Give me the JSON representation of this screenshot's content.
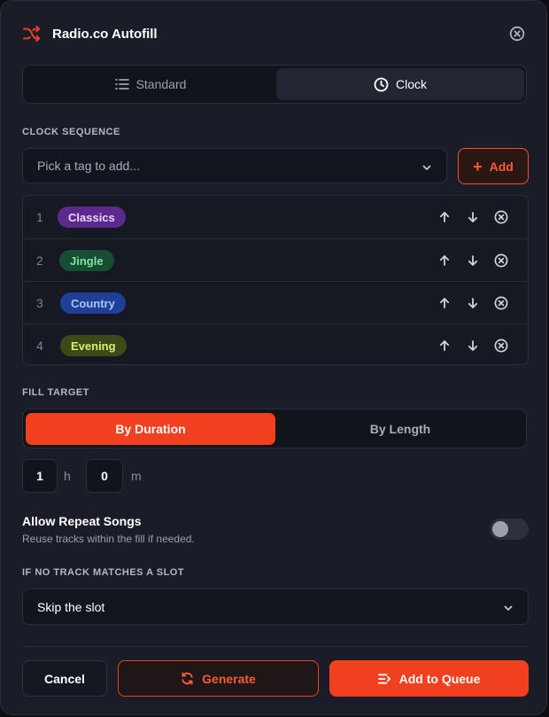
{
  "header": {
    "title": "Radio.co Autofill"
  },
  "mode_tabs": [
    {
      "label": "Standard",
      "icon": "list-icon"
    },
    {
      "label": "Clock",
      "icon": "clock-icon",
      "active": true
    }
  ],
  "clock_sequence": {
    "label": "CLOCK SEQUENCE",
    "picker_placeholder": "Pick a tag to add...",
    "add_label": "Add",
    "items": [
      {
        "num": "1",
        "tag": "Classics",
        "color": "#5b2a8c",
        "text_color": "#e7d6ff"
      },
      {
        "num": "2",
        "tag": "Jingle",
        "color": "#174d33",
        "text_color": "#7fe3a8"
      },
      {
        "num": "3",
        "tag": "Country",
        "color": "#1f3f96",
        "text_color": "#a9c4ff"
      },
      {
        "num": "4",
        "tag": "Evening",
        "color": "#3d4a17",
        "text_color": "#d9ef74"
      }
    ]
  },
  "fill_target": {
    "label": "FILL TARGET",
    "options": [
      "By Duration",
      "By Length"
    ],
    "selected": "By Duration",
    "hours_value": "1",
    "hours_unit": "h",
    "minutes_value": "0",
    "minutes_unit": "m"
  },
  "repeat": {
    "title": "Allow Repeat Songs",
    "description": "Reuse tracks within the fill if needed.",
    "enabled": false
  },
  "no_match": {
    "label": "IF NO TRACK MATCHES A SLOT",
    "value": "Skip the slot"
  },
  "footer": {
    "cancel": "Cancel",
    "generate": "Generate",
    "add_to_queue": "Add to Queue"
  },
  "colors": {
    "accent": "#f0401f",
    "surface": "#1a1d27",
    "border": "#2a2e3a"
  }
}
